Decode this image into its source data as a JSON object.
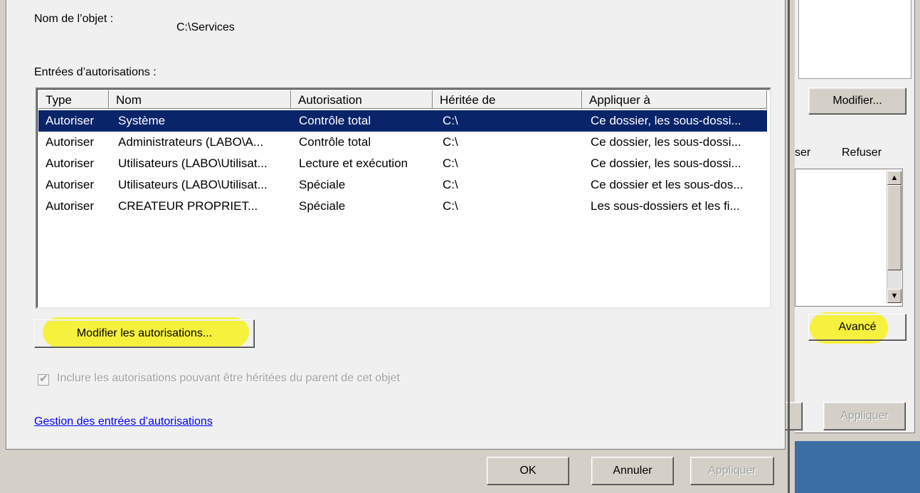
{
  "dialog": {
    "object_name_label": "Nom de l’objet :",
    "object_name_value": "C:\\Services",
    "entries_label": "Entrées d’autorisations :",
    "columns": [
      "Type",
      "Nom",
      "Autorisation",
      "Héritée de",
      "Appliquer à"
    ],
    "rows": [
      {
        "type": "Autoriser",
        "name": "Système",
        "permission": "Contrôle total",
        "inherited_from": "C:\\",
        "applies_to": "Ce dossier, les sous-dossi..."
      },
      {
        "type": "Autoriser",
        "name": "Administrateurs (LABO\\A...",
        "permission": "Contrôle total",
        "inherited_from": "C:\\",
        "applies_to": "Ce dossier, les sous-dossi..."
      },
      {
        "type": "Autoriser",
        "name": "Utilisateurs (LABO\\Utilisat...",
        "permission": "Lecture et exécution",
        "inherited_from": "C:\\",
        "applies_to": "Ce dossier, les sous-dossi..."
      },
      {
        "type": "Autoriser",
        "name": "Utilisateurs (LABO\\Utilisat...",
        "permission": "Spéciale",
        "inherited_from": "C:\\",
        "applies_to": "Ce dossier et les sous-dos..."
      },
      {
        "type": "Autoriser",
        "name": "CREATEUR PROPRIET...",
        "permission": "Spéciale",
        "inherited_from": "C:\\",
        "applies_to": "Les sous-dossiers et les fi..."
      }
    ],
    "selected_row": 0,
    "modify_permissions_button": "Modifier les autorisations...",
    "include_inheritable_checkbox": "Inclure les autorisations pouvant être héritées du parent de cet objet",
    "manage_entries_link": "Gestion des entrées d’autorisations",
    "ok_button": "OK",
    "cancel_button": "Annuler",
    "apply_button": "Appliquer"
  },
  "background_dialog": {
    "modify_button": "Modifier...",
    "allow_column_partial": "ser",
    "deny_column": "Refuser",
    "advanced_button": "Avancé",
    "apply_button": "Appliquer"
  },
  "colors": {
    "selection": "#0a246a",
    "highlight": "#f8f200",
    "link": "#0000ff",
    "desktop": "#3a6ea5"
  }
}
